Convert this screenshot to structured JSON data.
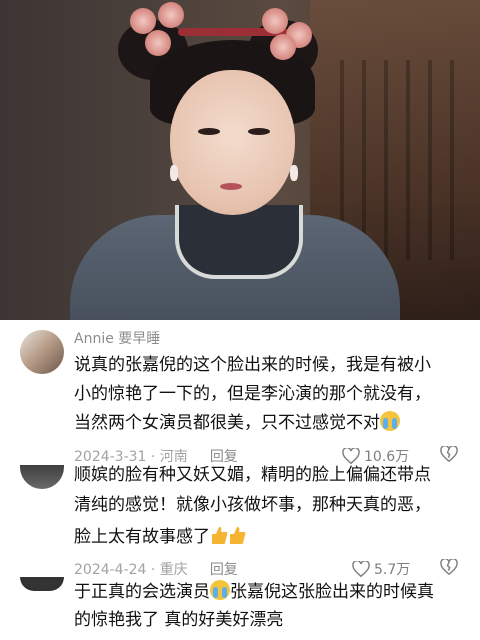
{
  "image": {
    "description_icon": "costume-drama-woman-photo"
  },
  "comments": [
    {
      "username": "Annie 要早睡",
      "lines": [
        "说真的张嘉倪的这个脸出来的时候，我是有被小",
        "小的惊艳了一下的，但是李沁演的那个就没有，",
        "当然两个女演员都很美，只不过感觉不对"
      ],
      "emoji": "cry-laugh-emoji",
      "meta": "2024-3-31 · 河南",
      "reply": "回复",
      "likes": "10.6万"
    },
    {
      "lines": [
        "顺嫔的脸有种又妖又媚，精明的脸上偏偏还带点",
        "清纯的感觉！就像小孩做坏事，那种天真的恶，",
        "脸上太有故事感了"
      ],
      "emoji": "thumbs-up-emoji",
      "meta": "2024-4-24 · 重庆",
      "reply": "回复",
      "likes": "5.7万"
    },
    {
      "line_a": "于正真的会选演员",
      "line_a_rest": "张嘉倪这张脸出来的时候真",
      "line_b": "的惊艳我了 真的好美好漂亮",
      "emoji": "crying-emoji"
    }
  ],
  "colors": {
    "like": "#7f7f7f",
    "meta": "#a3a3a3",
    "text": "#111111"
  }
}
